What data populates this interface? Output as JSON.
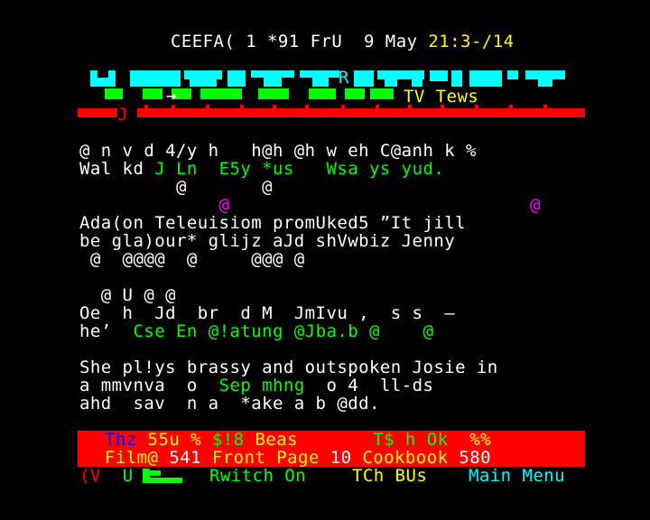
{
  "header": {
    "service": "CEEFA(",
    "page_num": "1 *91",
    "day": "FrU",
    "date": "9 May",
    "time": "21:3-/14",
    "logo_letter": "R",
    "section_label": "TV Tews",
    "sub_marker": "J",
    "arrow": "→"
  },
  "body": {
    "line1": "@ n v d 4/y h   h@h @h w eh C@anh k %",
    "line2_white": "Wal kd ",
    "line2_green": "J Ln  E5y *us   Wsa ys yud.",
    "line3": "         @       @",
    "line4_a": "             @",
    "line4_b": "             @",
    "line5": "Ada(on Teleuisiom promUked5 ”It jill",
    "line6": "be gla)our* glijz aJd shVwbiz Jenny",
    "line7": " @  @@@@  @     @@@ @",
    "line8": "  @ U @ @",
    "line9": "Oe  h  Jd  br  d M  JmIvu ,  s s  –",
    "line10_white": "he’  ",
    "line10_green": "Cse En @!atung @Jba.b @    @",
    "line11": "She pl!ys brassy and outspoken Josie in",
    "line12_a": "a mmvnva  o  ",
    "line12_green": "Sep mhng",
    "line12_b": "  o 4  ll-ds",
    "line13": "ahd  sav  n a  *ake a b @dd."
  },
  "fastext": {
    "row1_blue": "Thz",
    "row1_y1": " 55u % ",
    "row1_green": "$!8",
    "row1_y2": " Beas       ",
    "row1_green2": "T$ h Ok",
    "row1_y3": "  %%",
    "row2_film": "Film@",
    "row2_film_num": " 541 ",
    "row2_front": "Front Page",
    "row2_front_num": " 10 ",
    "row2_cook": "Cookbook",
    "row2_cook_num": " 580"
  },
  "footer": {
    "left": "(V",
    "u": "U",
    "switch": "Rwitch On",
    "tch": "TCh BUs",
    "main": "Main",
    "menu": "Menu"
  },
  "colors": {
    "background": "#000000",
    "white": "#ffffff",
    "yellow": "#ffff00",
    "green": "#00ff00",
    "cyan": "#00ffff",
    "magenta": "#ff00ff",
    "blue": "#0000ff",
    "red": "#ff0000"
  }
}
